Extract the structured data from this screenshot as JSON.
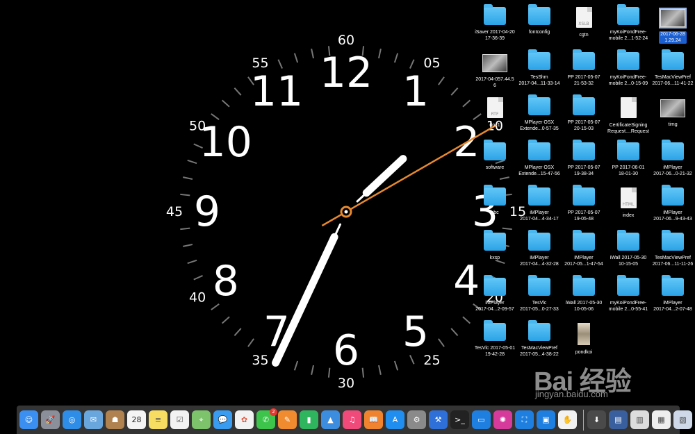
{
  "clock": {
    "hour_numbers": [
      "12",
      "1",
      "2",
      "3",
      "4",
      "5",
      "6",
      "7",
      "8",
      "9",
      "10",
      "11"
    ],
    "minute_numbers": [
      "60",
      "05",
      "10",
      "15",
      "20",
      "25",
      "30",
      "35",
      "40",
      "45",
      "50",
      "55"
    ],
    "time": {
      "hours": 1,
      "minutes": 34,
      "seconds": 10
    },
    "colors": {
      "hands": "#ffffff",
      "second_hand": "#e8892e",
      "ticks": "#777777"
    }
  },
  "desktop_icons": [
    {
      "label": "iSaver 2017-04-20\n17-36-39",
      "kind": "folder",
      "icon": "folder-icon"
    },
    {
      "label": "fontconfig",
      "kind": "folder",
      "icon": "folder-icon"
    },
    {
      "label": "cgtn",
      "kind": "document",
      "icon": "document-icon",
      "doc_tag": "XSLB"
    },
    {
      "label": "myKoiPondFree-\nmobile 2...1-52-24",
      "kind": "folder",
      "icon": "folder-icon"
    },
    {
      "label": "2017-06-28\n1.29.24",
      "kind": "image",
      "icon": "screenshot-thumbnail-icon",
      "selected": true
    },
    {
      "label": "2017-04-057.44.5\n6",
      "kind": "image",
      "icon": "screenshot-thumbnail-icon"
    },
    {
      "label": "TesShm\n2017-04...11-33-14",
      "kind": "folder",
      "icon": "folder-icon"
    },
    {
      "label": "PP 2017-05-07\n21-53-32",
      "kind": "folder",
      "icon": "folder-icon"
    },
    {
      "label": "myKoiPondFree-\nmobile 2...0-15-09",
      "kind": "folder",
      "icon": "folder-icon"
    },
    {
      "label": "TesMacViewPref\n2017-06...11-41-22",
      "kind": "folder",
      "icon": "folder-icon"
    },
    {
      "label": "doc1",
      "kind": "document",
      "icon": "document-icon",
      "doc_tag": "RTF"
    },
    {
      "label": "MPlayer OSX\nExtende...0-57-35",
      "kind": "folder",
      "icon": "folder-icon"
    },
    {
      "label": "PP 2017-05-07\n20-15-03",
      "kind": "folder",
      "icon": "folder-icon"
    },
    {
      "label": "CertificateSigning\nRequest....Request",
      "kind": "document",
      "icon": "document-icon",
      "doc_tag": ""
    },
    {
      "label": "timg",
      "kind": "image",
      "icon": "image-thumbnail-icon"
    },
    {
      "label": "software",
      "kind": "folder",
      "icon": "folder-icon"
    },
    {
      "label": "MPlayer OSX\nExtende...15-47-56",
      "kind": "folder",
      "icon": "folder-icon"
    },
    {
      "label": "PP 2017-05-07\n19-38-34",
      "kind": "folder",
      "icon": "folder-icon"
    },
    {
      "label": "PP 2017-06-01\n18-01-30",
      "kind": "folder",
      "icon": "folder-icon"
    },
    {
      "label": "iMPlayer\n2017-06...0-21-32",
      "kind": "folder",
      "icon": "folder-icon"
    },
    {
      "label": "abc",
      "kind": "folder",
      "icon": "folder-icon"
    },
    {
      "label": "iMPlayer\n2017-04...4-34-17",
      "kind": "folder",
      "icon": "folder-icon"
    },
    {
      "label": "PP 2017-05-07\n19-05-48",
      "kind": "folder",
      "icon": "folder-icon"
    },
    {
      "label": "index",
      "kind": "document",
      "icon": "document-icon",
      "doc_tag": "HTML"
    },
    {
      "label": "iMPlayer\n2017-06...9-43-43",
      "kind": "folder",
      "icon": "folder-icon"
    },
    {
      "label": "kxsp",
      "kind": "folder",
      "icon": "folder-icon"
    },
    {
      "label": "iMPlayer\n2017-04...4-32-28",
      "kind": "folder",
      "icon": "folder-icon"
    },
    {
      "label": "iMPlayer\n2017-05...1-47-54",
      "kind": "folder",
      "icon": "folder-icon"
    },
    {
      "label": "iWall 2017-05-30\n10-15-05",
      "kind": "folder",
      "icon": "folder-icon"
    },
    {
      "label": "TesMacViewPref\n2017-06...11-11-26",
      "kind": "folder",
      "icon": "folder-icon"
    },
    {
      "label": "iMPlayer\n2017-04...2-09-57",
      "kind": "folder",
      "icon": "folder-icon"
    },
    {
      "label": "TesVlc\n2017-05...0-27-33",
      "kind": "folder",
      "icon": "folder-icon"
    },
    {
      "label": "iWall 2017-05-30\n10-05-06",
      "kind": "folder",
      "icon": "folder-icon"
    },
    {
      "label": "myKoiPondFree-\nmobile 2...0-55-41",
      "kind": "folder",
      "icon": "folder-icon"
    },
    {
      "label": "iMPlayer\n2017-04...2-07-48",
      "kind": "folder",
      "icon": "folder-icon"
    },
    {
      "label": "TesVlc 2017-05-01\n19-42-28",
      "kind": "folder",
      "icon": "folder-icon"
    },
    {
      "label": "TesMacViewPref\n2017-05...4-38-22",
      "kind": "folder",
      "icon": "folder-icon"
    },
    {
      "label": "pondkoi",
      "kind": "photo",
      "icon": "photo-thumbnail-icon"
    }
  ],
  "dock": {
    "apps": [
      {
        "icon": "finder-icon",
        "color": "#3b8ff0",
        "glyph": "☺"
      },
      {
        "icon": "launchpad-icon",
        "color": "#8a8f99",
        "glyph": "🚀"
      },
      {
        "icon": "safari-icon",
        "color": "#2e8de6",
        "glyph": "◎"
      },
      {
        "icon": "mail-icon",
        "color": "#6aa6de",
        "glyph": "✉"
      },
      {
        "icon": "contacts-icon",
        "color": "#b08250",
        "glyph": "☗"
      },
      {
        "icon": "calendar-icon",
        "color": "#f4f4f4",
        "glyph": "28",
        "text_color": "#222"
      },
      {
        "icon": "notes-icon",
        "color": "#f7dd62",
        "glyph": "≡",
        "text_color": "#555"
      },
      {
        "icon": "reminders-icon",
        "color": "#f2f2f2",
        "glyph": "☑",
        "text_color": "#555"
      },
      {
        "icon": "maps-icon",
        "color": "#7cc36b",
        "glyph": "⌖"
      },
      {
        "icon": "messages-icon",
        "color": "#3a9cf0",
        "glyph": "💬"
      },
      {
        "icon": "photos-icon",
        "color": "#f2f2f2",
        "glyph": "✿",
        "text_color": "#e4573d"
      },
      {
        "icon": "facetime-icon",
        "color": "#3cc44b",
        "glyph": "✆",
        "badge": "2"
      },
      {
        "icon": "pages-icon",
        "color": "#f08c2f",
        "glyph": "✎"
      },
      {
        "icon": "numbers-icon",
        "color": "#2fb55d",
        "glyph": "▮"
      },
      {
        "icon": "keynote-icon",
        "color": "#3c8de0",
        "glyph": "▲"
      },
      {
        "icon": "itunes-icon",
        "color": "#f04a7a",
        "glyph": "♫"
      },
      {
        "icon": "ibooks-icon",
        "color": "#f0842e",
        "glyph": "📖"
      },
      {
        "icon": "app-store-icon",
        "color": "#1f8ef0",
        "glyph": "A"
      },
      {
        "icon": "system-preferences-icon",
        "color": "#8a8a8a",
        "glyph": "⚙"
      },
      {
        "icon": "xcode-icon",
        "color": "#2f6fd8",
        "glyph": "⚒"
      },
      {
        "icon": "terminal-icon",
        "color": "#222222",
        "glyph": ">_"
      },
      {
        "icon": "screen-sharing-icon",
        "color": "#1f7fe0",
        "glyph": "▭"
      },
      {
        "icon": "koi-pond-icon",
        "color": "#d63b9c",
        "glyph": "✺"
      },
      {
        "icon": "remote-desktop-icon",
        "color": "#1f7fe0",
        "glyph": "⛶"
      },
      {
        "icon": "monitor-icon",
        "color": "#1f7fe0",
        "glyph": "▣"
      },
      {
        "icon": "paint-icon",
        "color": "#f2f2f2",
        "glyph": "✋",
        "text_color": "#d33"
      }
    ],
    "docs": [
      {
        "icon": "downloads-stack-icon",
        "color": "#4a4a4a",
        "glyph": "⬇"
      },
      {
        "icon": "screenshot-stack-icon",
        "color": "#3a5f9e",
        "glyph": "▤"
      },
      {
        "icon": "document-stack-icon",
        "color": "#dddddd",
        "glyph": "▥",
        "text_color": "#444"
      },
      {
        "icon": "window-stack-icon",
        "color": "#eeeeee",
        "glyph": "▦",
        "text_color": "#444"
      },
      {
        "icon": "folder-stack-icon",
        "color": "#cfd8e8",
        "glyph": "▧",
        "text_color": "#444"
      },
      {
        "icon": "trash-icon",
        "color": "#bcbcbc",
        "glyph": "🗑",
        "text_color": "#333"
      }
    ]
  },
  "watermark": {
    "main": "Bai 经验",
    "sub": "jingyan.baidu.com"
  }
}
